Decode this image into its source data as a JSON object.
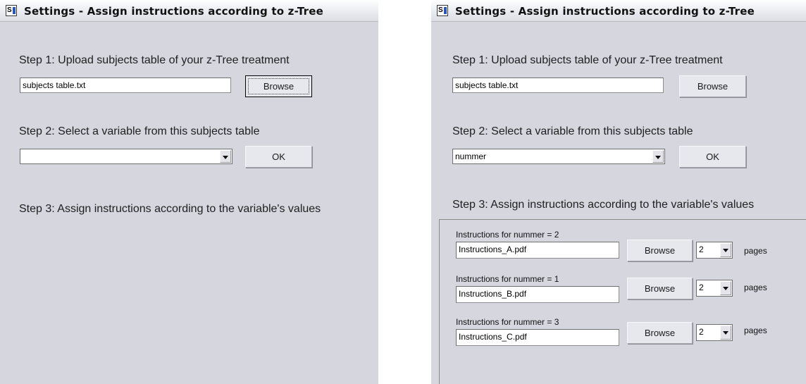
{
  "left_window": {
    "title": "Settings - Assign instructions according to z-Tree",
    "icon_letter": "S",
    "step1": {
      "label": "Step 1: Upload subjects table of your z-Tree treatment",
      "file_value": "subjects table.txt",
      "browse_label": "Browse"
    },
    "step2": {
      "label": "Step 2: Select a variable from this subjects table",
      "selected_variable": "",
      "ok_label": "OK"
    },
    "step3": {
      "label": "Step 3: Assign instructions according to the variable's values"
    }
  },
  "right_window": {
    "title": "Settings - Assign instructions according to z-Tree",
    "icon_letter": "S",
    "step1": {
      "label": "Step 1: Upload subjects table of your z-Tree treatment",
      "file_value": "subjects table.txt",
      "browse_label": "Browse"
    },
    "step2": {
      "label": "Step 2: Select a variable from this subjects table",
      "selected_variable": "nummer",
      "ok_label": "OK"
    },
    "step3": {
      "label": "Step 3: Assign instructions according to the variable's values",
      "rows": [
        {
          "label": "Instructions for nummer = 2",
          "file": "Instructions_A.pdf",
          "browse_label": "Browse",
          "pages_value": "2",
          "pages_label": "pages"
        },
        {
          "label": "Instructions for nummer = 1",
          "file": "Instructions_B.pdf",
          "browse_label": "Browse",
          "pages_value": "2",
          "pages_label": "pages"
        },
        {
          "label": "Instructions for nummer = 3",
          "file": "Instructions_C.pdf",
          "browse_label": "Browse",
          "pages_value": "2",
          "pages_label": "pages"
        }
      ]
    }
  }
}
